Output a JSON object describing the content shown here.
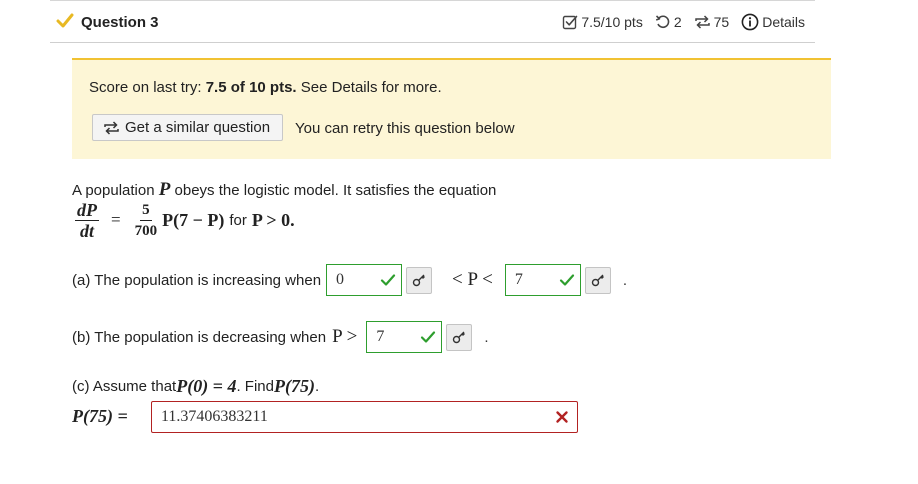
{
  "header": {
    "title": "Question 3",
    "score": "7.5/10 pts",
    "attempts": "2",
    "retries": "75",
    "details_label": "Details"
  },
  "banner": {
    "score_prefix": "Score on last try: ",
    "score_value": "7.5 of 10 pts.",
    "score_suffix": " See Details for more.",
    "similar_button_label": "Get a similar question",
    "retry_text": "You can retry this question below"
  },
  "problem": {
    "statement_pre": "A population ",
    "statement_var": "P",
    "statement_post": " obeys the logistic model. It satisfies the equation",
    "eq_lhs_num": "dP",
    "eq_lhs_den": "dt",
    "eq_equals": "=",
    "eq_coef_num": "5",
    "eq_coef_den": "700",
    "eq_rhs": "P(7 − P)",
    "eq_for": "for",
    "eq_condition": "P > 0."
  },
  "part_a": {
    "label": "(a) The population is increasing when",
    "lower_value": "0",
    "middle": "< P <",
    "upper_value": "7",
    "end": "."
  },
  "part_b": {
    "label": "(b) The population is decreasing when",
    "expr": "P >",
    "value": "7",
    "end": "."
  },
  "part_c": {
    "label_pre": "(c) Assume that ",
    "label_eq": "P(0) = 4",
    "label_mid": ". Find ",
    "label_target": "P(75)",
    "label_end": ".",
    "answer_label": "P(75) =",
    "answer_value": "11.37406383211"
  },
  "colors": {
    "correct": "#2e9e2e",
    "incorrect": "#b22222",
    "banner_bg": "#fdf6d6",
    "banner_border": "#f1c232",
    "check_yellow": "#e8b923"
  }
}
